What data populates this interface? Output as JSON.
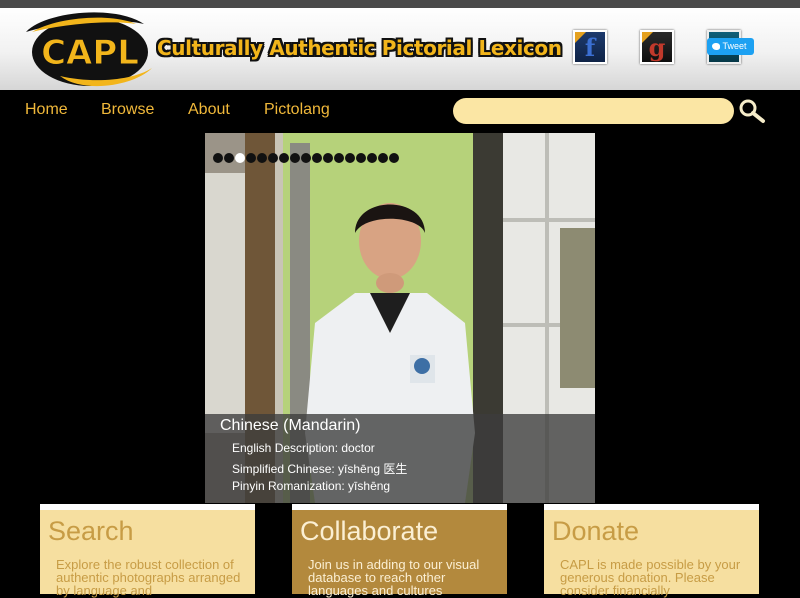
{
  "header": {
    "site_title": "Culturally Authentic Pictorial Lexicon",
    "logo_text": "CAPL",
    "social": {
      "facebook_glyph": "f",
      "google_glyph": "g",
      "tweet_label": "Tweet"
    }
  },
  "nav": {
    "items": [
      {
        "label": "Home"
      },
      {
        "label": "Browse"
      },
      {
        "label": "About"
      },
      {
        "label": "Pictolang"
      }
    ]
  },
  "search": {
    "placeholder": "",
    "value": "",
    "icon": "magnifier-icon"
  },
  "slideshow": {
    "dot_count": 17,
    "active_index": 2,
    "caption": {
      "language": "Chinese (Mandarin)",
      "english": "English Description: doctor",
      "simplified": "Simplified Chinese: yīshēng 医生",
      "pinyin": "Pinyin Romanization: yīshēng"
    }
  },
  "features": [
    {
      "title": "Search",
      "text": "Explore the robust collection of authentic photographs arranged by language and"
    },
    {
      "title": "Collaborate",
      "text": "Join us in adding to our visual database to reach other languages and cultures"
    },
    {
      "title": "Donate",
      "text": "CAPL is made possible by your generous donation. Please consider financially"
    }
  ],
  "colors": {
    "nav_text": "#f0b83a",
    "search_fill": "#fbe6a4",
    "box_light": "#f6dfa0",
    "box_dark": "#b3893d"
  }
}
